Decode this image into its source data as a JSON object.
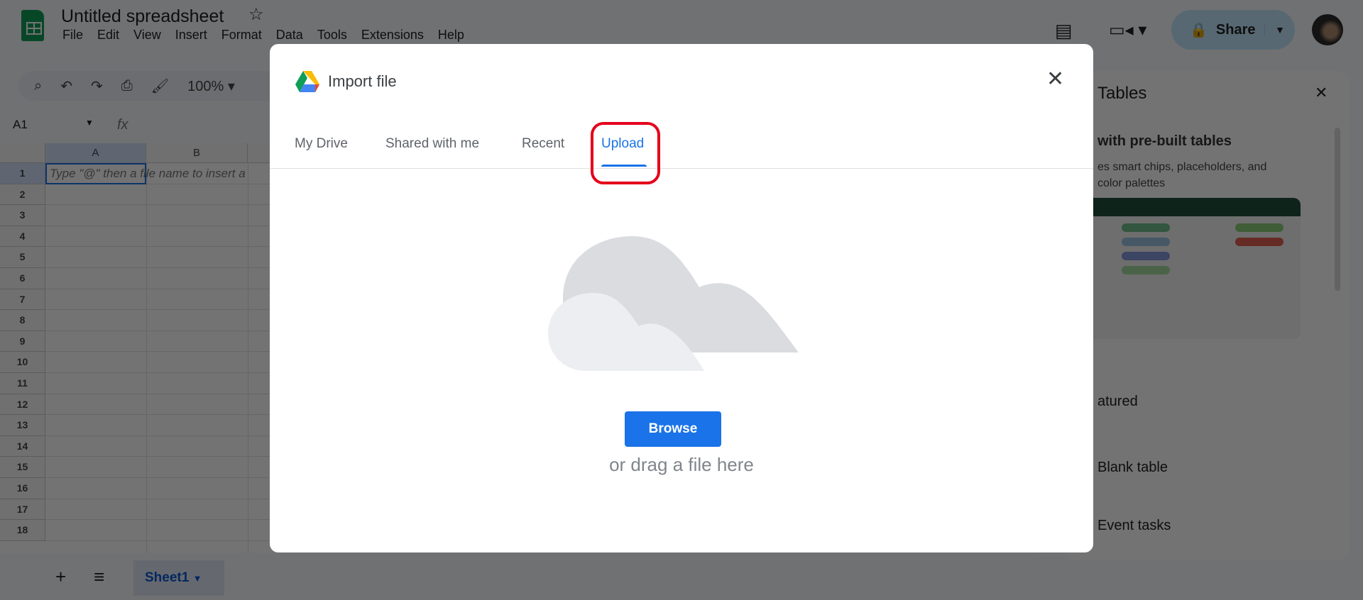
{
  "app": {
    "title": "Untitled spreadsheet",
    "menu": [
      "File",
      "Edit",
      "View",
      "Insert",
      "Format",
      "Data",
      "Tools",
      "Extensions",
      "Help"
    ],
    "zoom": "100%",
    "name_box": "A1",
    "fx": "fx",
    "share_label": "Share"
  },
  "grid": {
    "columns": [
      "A",
      "B"
    ],
    "rows": [
      "1",
      "2",
      "3",
      "4",
      "5",
      "6",
      "7",
      "8",
      "9",
      "10",
      "11",
      "12",
      "13",
      "14",
      "15",
      "16",
      "17",
      "18"
    ],
    "cell_hint": "Type \"@\" then a file name to insert a"
  },
  "sheets": {
    "add": "+",
    "list": "≡",
    "tabs": [
      "Sheet1"
    ]
  },
  "panel": {
    "title": "Tables",
    "subtitle": "with pre-built tables",
    "desc1": "es smart chips, placeholders, and",
    "desc2": "color palettes",
    "section": "atured",
    "items": [
      "Blank table",
      "Event tasks"
    ]
  },
  "dialog": {
    "title": "Import file",
    "tabs": [
      "My Drive",
      "Shared with me",
      "Recent",
      "Upload"
    ],
    "active_tab": "Upload",
    "browse": "Browse",
    "drag_text": "or drag a file here",
    "accent": "#1a73e8",
    "highlight_color": "#e4001b"
  }
}
